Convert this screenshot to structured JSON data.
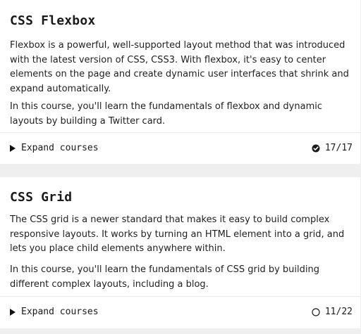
{
  "courses": [
    {
      "title": "CSS Flexbox",
      "paragraphs": [
        "Flexbox is a powerful, well-supported layout method that was introduced with the latest version of CSS, CSS3. With flexbox, it's easy to center elements on the page and create dynamic user interfaces that shrink and expand automatically.",
        "In this course, you'll learn the fundamentals of flexbox and dynamic layouts by building a Twitter card."
      ],
      "expand_label": "Expand courses",
      "progress": "17/17",
      "completed": 17,
      "total": 17,
      "status_icon": "check-circle-icon"
    },
    {
      "title": "CSS Grid",
      "paragraphs": [
        "The CSS grid is a newer standard that makes it easy to build complex responsive layouts. It works by turning an HTML element into a grid, and lets you place child elements anywhere within.",
        "In this course, you'll learn the fundamentals of CSS grid by building different complex layouts, including a blog."
      ],
      "expand_label": "Expand courses",
      "progress": "11/22",
      "completed": 11,
      "total": 22,
      "status_icon": "empty-circle-icon"
    }
  ],
  "colors": {
    "page_background": "#efefef",
    "card_background": "#ffffff",
    "text": "#1a1a1a",
    "divider": "#ececec"
  }
}
